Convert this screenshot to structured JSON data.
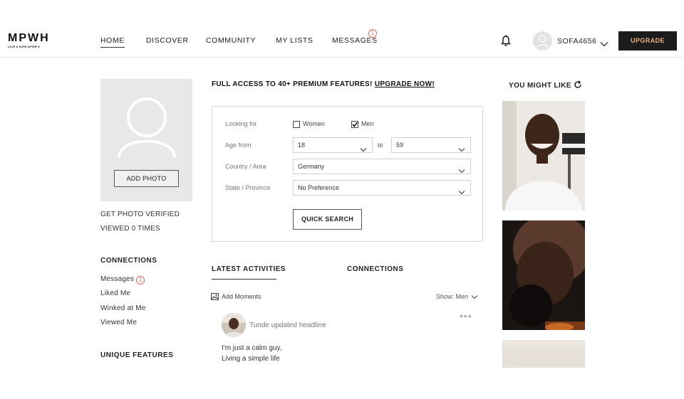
{
  "brand": {
    "name": "MPWH",
    "tagline": "LOVE & HOPE AFTER H"
  },
  "nav": {
    "home": "HOME",
    "discover": "DISCOVER",
    "community": "COMMUNITY",
    "my_lists": "MY LISTS",
    "messages": "MESSAGES",
    "messages_count": "1"
  },
  "user": {
    "username": "SOFA4656",
    "upgrade_label": "UPGRADE"
  },
  "profile": {
    "add_photo": "ADD PHOTO",
    "get_verified": "GET PHOTO VERIFIED",
    "viewed": "VIEWED 0 TIMES"
  },
  "connections": {
    "heading": "CONNECTIONS",
    "messages": "Messages",
    "messages_count": "1",
    "liked_me": "Liked Me",
    "winked_at_me": "Winked at Me",
    "viewed_me": "Viewed Me"
  },
  "unique_features": "UNIQUE FEATURES",
  "promo": {
    "text": "FULL ACCESS TO 40+ PREMIUM FEATURES! ",
    "link": "UPGRADE NOW!"
  },
  "search": {
    "looking_for_label": "Looking for",
    "women_label": "Women",
    "women_checked": false,
    "men_label": "Men",
    "men_checked": true,
    "age_from_label": "Age from",
    "age_from": "18",
    "to_label": "to",
    "age_to": "59",
    "country_label": "Country / Area",
    "country": "Germany",
    "state_label": "State / Province",
    "state": "No Preference",
    "quick_search": "QUICK SEARCH"
  },
  "tabs": {
    "latest": "LATEST ACTIVITIES",
    "connections": "CONNECTIONS"
  },
  "activity": {
    "add_moments": "Add Moments",
    "show": "Show: Men",
    "headline": "Tunde updated headline",
    "post_line1": "I'm just a calm guy,",
    "post_line2": "Living a simple life"
  },
  "suggestions": {
    "heading": "YOU MIGHT LIKE"
  },
  "colors": {
    "accent_badge": "#e06a5a",
    "upgrade_bg": "#1c1c1c",
    "upgrade_text": "#e8b27a"
  }
}
